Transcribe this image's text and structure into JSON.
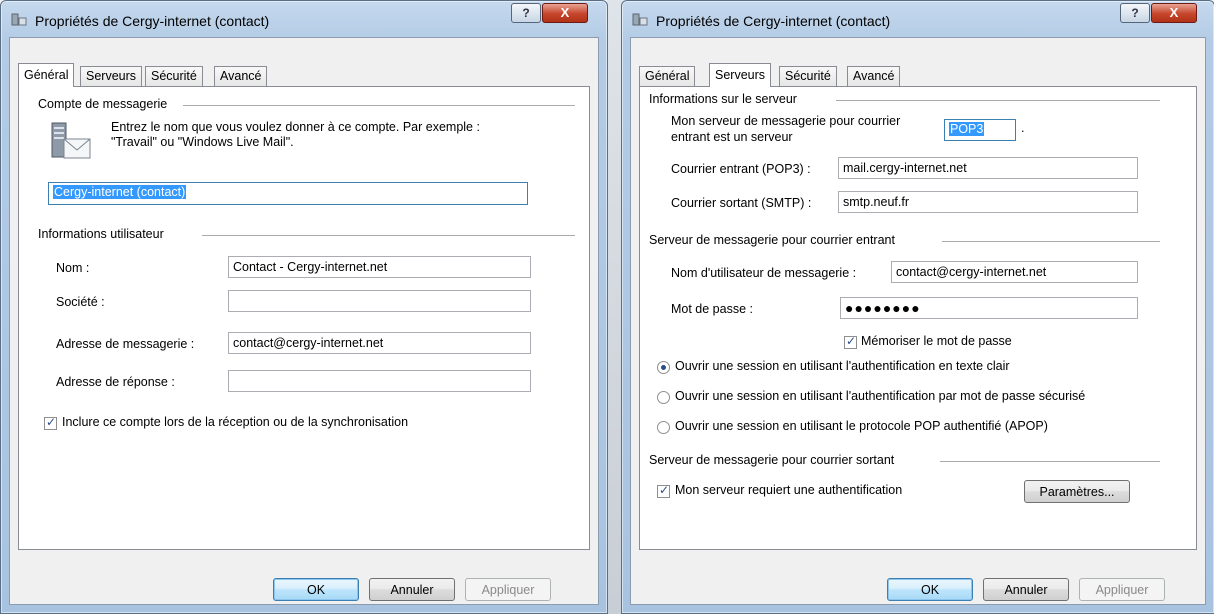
{
  "left_window": {
    "title": "Propriétés de Cergy-internet (contact)",
    "help_label": "?",
    "close_label": "X",
    "tabs": [
      "Général",
      "Serveurs",
      "Sécurité",
      "Avancé"
    ],
    "active_tab": "Général",
    "account_group": {
      "title": "Compte de messagerie",
      "description": "Entrez le nom que vous voulez donner à ce compte. Par exemple : \"Travail\" ou \"Windows Live Mail\".",
      "account_name_value": "Cergy-internet (contact)",
      "icon": "mail-server-icon"
    },
    "user_group": {
      "title": "Informations utilisateur",
      "name_label": "Nom :",
      "name_value": "Contact - Cergy-internet.net",
      "company_label": "Société :",
      "company_value": "",
      "email_label": "Adresse de messagerie :",
      "email_value": "contact@cergy-internet.net",
      "reply_label": "Adresse de réponse :",
      "reply_value": ""
    },
    "include_checkbox": {
      "label": "Inclure ce compte lors de la réception ou de la synchronisation",
      "checked": true
    },
    "buttons": {
      "ok": "OK",
      "cancel": "Annuler",
      "apply": "Appliquer"
    }
  },
  "right_window": {
    "title": "Propriétés de Cergy-internet (contact)",
    "help_label": "?",
    "close_label": "X",
    "tabs": [
      "Général",
      "Serveurs",
      "Sécurité",
      "Avancé"
    ],
    "active_tab": "Serveurs",
    "server_info": {
      "title": "Informations sur le serveur",
      "incoming_type_label_1": "Mon serveur de messagerie pour courrier",
      "incoming_type_label_2": "entrant est un serveur",
      "incoming_type_value": "POP3",
      "incoming_type_suffix": ".",
      "incoming_label": "Courrier entrant (POP3) :",
      "incoming_value": "mail.cergy-internet.net",
      "outgoing_label": "Courrier sortant (SMTP) :",
      "outgoing_value": "smtp.neuf.fr"
    },
    "incoming_server": {
      "title": "Serveur de messagerie pour courrier entrant",
      "username_label": "Nom d'utilisateur de messagerie :",
      "username_value": "contact@cergy-internet.net",
      "password_label": "Mot de passe :",
      "password_value": "●●●●●●●●",
      "remember_label": "Mémoriser le mot de passe",
      "remember_checked": true,
      "auth_options": [
        {
          "label": "Ouvrir une session en utilisant l'authentification en texte clair",
          "checked": true
        },
        {
          "label": "Ouvrir une session en utilisant l'authentification par mot de passe sécurisé",
          "checked": false
        },
        {
          "label": "Ouvrir une session en utilisant le protocole POP authentifié (APOP)",
          "checked": false
        }
      ]
    },
    "outgoing_server": {
      "title": "Serveur de messagerie pour courrier sortant",
      "auth_label": "Mon serveur requiert une authentification",
      "auth_checked": true,
      "settings_label": "Paramètres..."
    },
    "buttons": {
      "ok": "OK",
      "cancel": "Annuler",
      "apply": "Appliquer"
    }
  }
}
